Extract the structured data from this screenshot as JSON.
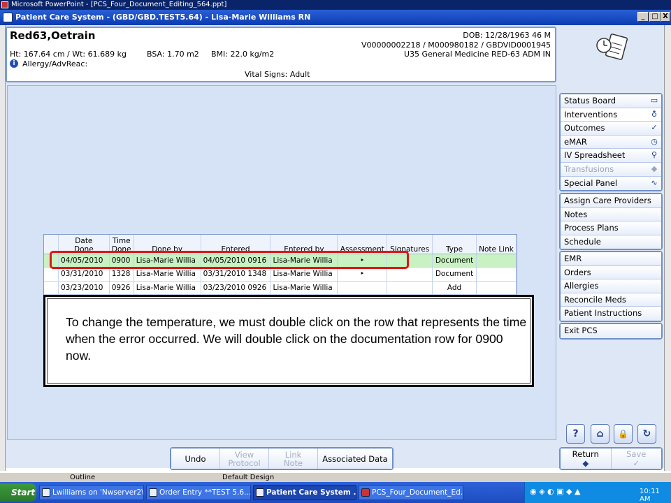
{
  "ppt_window": {
    "title": "Microsoft PowerPoint - [PCS_Four_Document_Editing_564.ppt]",
    "status_left": "Outline",
    "status_center": "Default Design"
  },
  "pcs_window": {
    "title": "Patient Care System - (GBD/GBD.TEST5.64) - Lisa-Marie Williams RN",
    "minimize": "_",
    "maximize": "□",
    "close": "X"
  },
  "patient": {
    "name": "Red63,Oetrain",
    "ht_wt": "Ht: 167.64 cm / Wt: 61.689 kg",
    "bsa": "BSA: 1.70 m2",
    "bmi": "BMI: 22.0 kg/m2",
    "allergy": "Allergy/AdvReac:",
    "dob": "DOB: 12/28/1963 46 M",
    "ids": "V00000002218 / M000980182 / GBDVID0001945",
    "location": "U35 General Medicine RED-63 ADM IN",
    "section_title": "Vital Signs: Adult"
  },
  "grid": {
    "columns": [
      {
        "label1": "Date",
        "label2": "Done"
      },
      {
        "label1": "Time",
        "label2": "Done"
      },
      {
        "label1": "",
        "label2": "Done by"
      },
      {
        "label1": "",
        "label2": "Entered"
      },
      {
        "label1": "",
        "label2": "Entered by"
      },
      {
        "label1": "",
        "label2": "Assessment"
      },
      {
        "label1": "",
        "label2": "Signatures"
      },
      {
        "label1": "",
        "label2": "Type"
      },
      {
        "label1": "",
        "label2": "Note Link"
      }
    ],
    "rows": [
      {
        "date": "04/05/2010",
        "time": "0900",
        "done_by": "Lisa-Marie Willia",
        "entered": "04/05/2010 0916",
        "entered_by": "Lisa-Marie Willia",
        "assessment": "‣",
        "signatures": "",
        "type": "Document",
        "note_link": ""
      },
      {
        "date": "03/31/2010",
        "time": "1328",
        "done_by": "Lisa-Marie Willia",
        "entered": "03/31/2010 1348",
        "entered_by": "Lisa-Marie Willia",
        "assessment": "‣",
        "signatures": "",
        "type": "Document",
        "note_link": ""
      },
      {
        "date": "03/23/2010",
        "time": "0926",
        "done_by": "Lisa-Marie Willia",
        "entered": "03/23/2010 0926",
        "entered_by": "Lisa-Marie Willia",
        "assessment": "",
        "signatures": "",
        "type": "Add",
        "note_link": ""
      }
    ]
  },
  "callout": {
    "text": "To change the temperature, we must double click on the row that represents the time when the error occurred. We will double click on the documentation row for 0900 now."
  },
  "nav": {
    "group1": [
      {
        "label": "Status Board",
        "icon": "book-icon"
      },
      {
        "label": "Interventions",
        "icon": "stethoscope-icon"
      },
      {
        "label": "Outcomes",
        "icon": "checklist-icon"
      },
      {
        "label": "eMAR",
        "icon": "clock-doc-icon"
      },
      {
        "label": "IV Spreadsheet",
        "icon": "iv-icon"
      },
      {
        "label": "Transfusions",
        "icon": "blood-drop-icon"
      },
      {
        "label": "Special Panel",
        "icon": "pulse-icon"
      }
    ],
    "group2": [
      {
        "label": "Assign Care Providers"
      },
      {
        "label": "Notes"
      },
      {
        "label": "Process Plans"
      },
      {
        "label": "Schedule"
      }
    ],
    "group3": [
      {
        "label": "EMR"
      },
      {
        "label": "Orders"
      },
      {
        "label": "Allergies"
      },
      {
        "label": "Reconcile Meds"
      },
      {
        "label": "Patient Instructions"
      }
    ],
    "group4": [
      {
        "label": "Exit PCS"
      }
    ]
  },
  "help_buttons": [
    "?",
    "⌂",
    "🔒",
    "↻"
  ],
  "actions": {
    "undo": "Undo",
    "view_protocol_1": "View",
    "view_protocol_2": "Protocol",
    "link_note_1": "Link",
    "link_note_2": "Note",
    "associated_data": "Associated Data"
  },
  "return_save": {
    "return": "Return",
    "return_arrow": "◆",
    "save": "Save",
    "save_check": "✓"
  },
  "taskbar": {
    "start": "Start",
    "tasks": [
      "Lwilliams on 'Nwserver2\\...",
      "Order Entry **TEST 5.6...",
      "Patient Care System ...",
      "PCS_Four_Document_Ed..."
    ],
    "clock": "10:11 AM"
  }
}
